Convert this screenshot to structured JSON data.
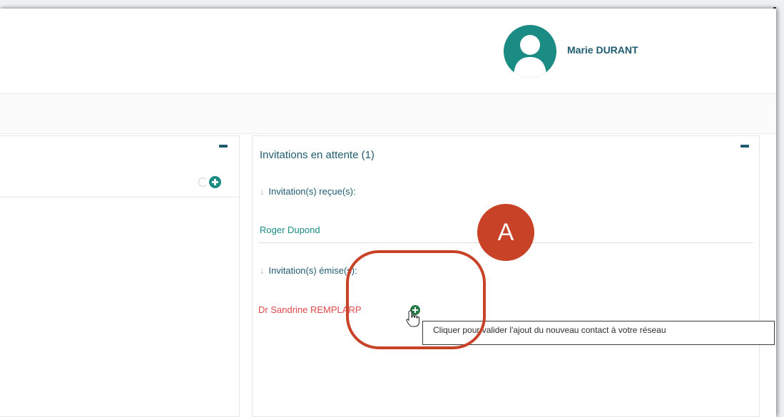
{
  "header": {
    "user_name": "Marie DURANT"
  },
  "left_panel": {
    "collapse_icon": "minus-icon",
    "refresh_icon": "refresh-icon",
    "add_icon": "plus-circle-icon"
  },
  "invitations_panel": {
    "title": "Invitations en attente (1)",
    "received": {
      "heading": "Invitation(s) reçue(s):",
      "contacts": [
        "Roger Dupond"
      ]
    },
    "sent": {
      "heading": "Invitation(s) émise(s):",
      "contacts": [
        "Dr Sandrine REMPLARP"
      ]
    },
    "tooltip": "Cliquer pour valider l'ajout du nouveau contact à votre réseau"
  },
  "annotation": {
    "badge_label": "A"
  },
  "colors": {
    "primary": "#1f5b6e",
    "accent": "#1a8c83",
    "sent_contact": "#e0484a",
    "validate": "#237a45",
    "annotation": "#c84227"
  }
}
